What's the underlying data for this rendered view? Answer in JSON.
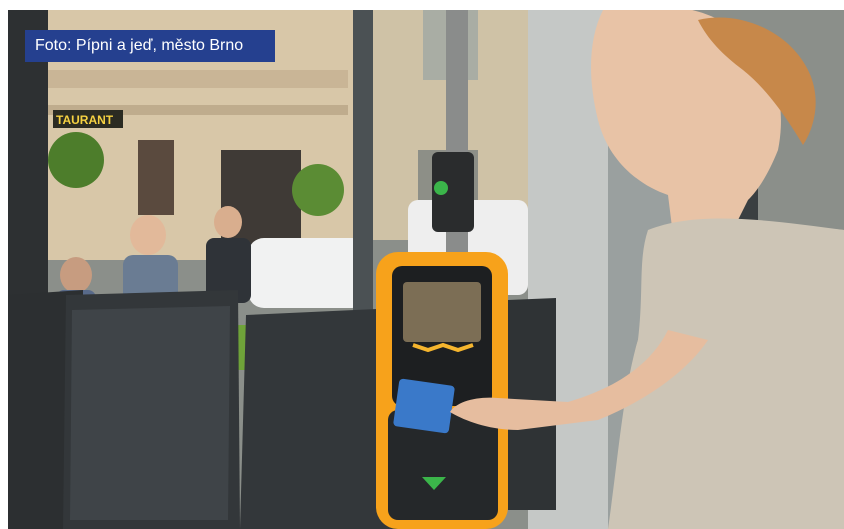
{
  "caption": {
    "text": "Foto: Pípni a jeď, město Brno",
    "background_color": "#25408f"
  },
  "scene": {
    "sign_text": "TAURANT",
    "validator": {
      "body_color": "#f7a21b",
      "screen_color": "#1d1f21",
      "arrow_color": "#3bb54a"
    },
    "card_color": "#3a79c9"
  },
  "icons": [
    "validator-arrow-icon",
    "validator-status-light-icon"
  ]
}
